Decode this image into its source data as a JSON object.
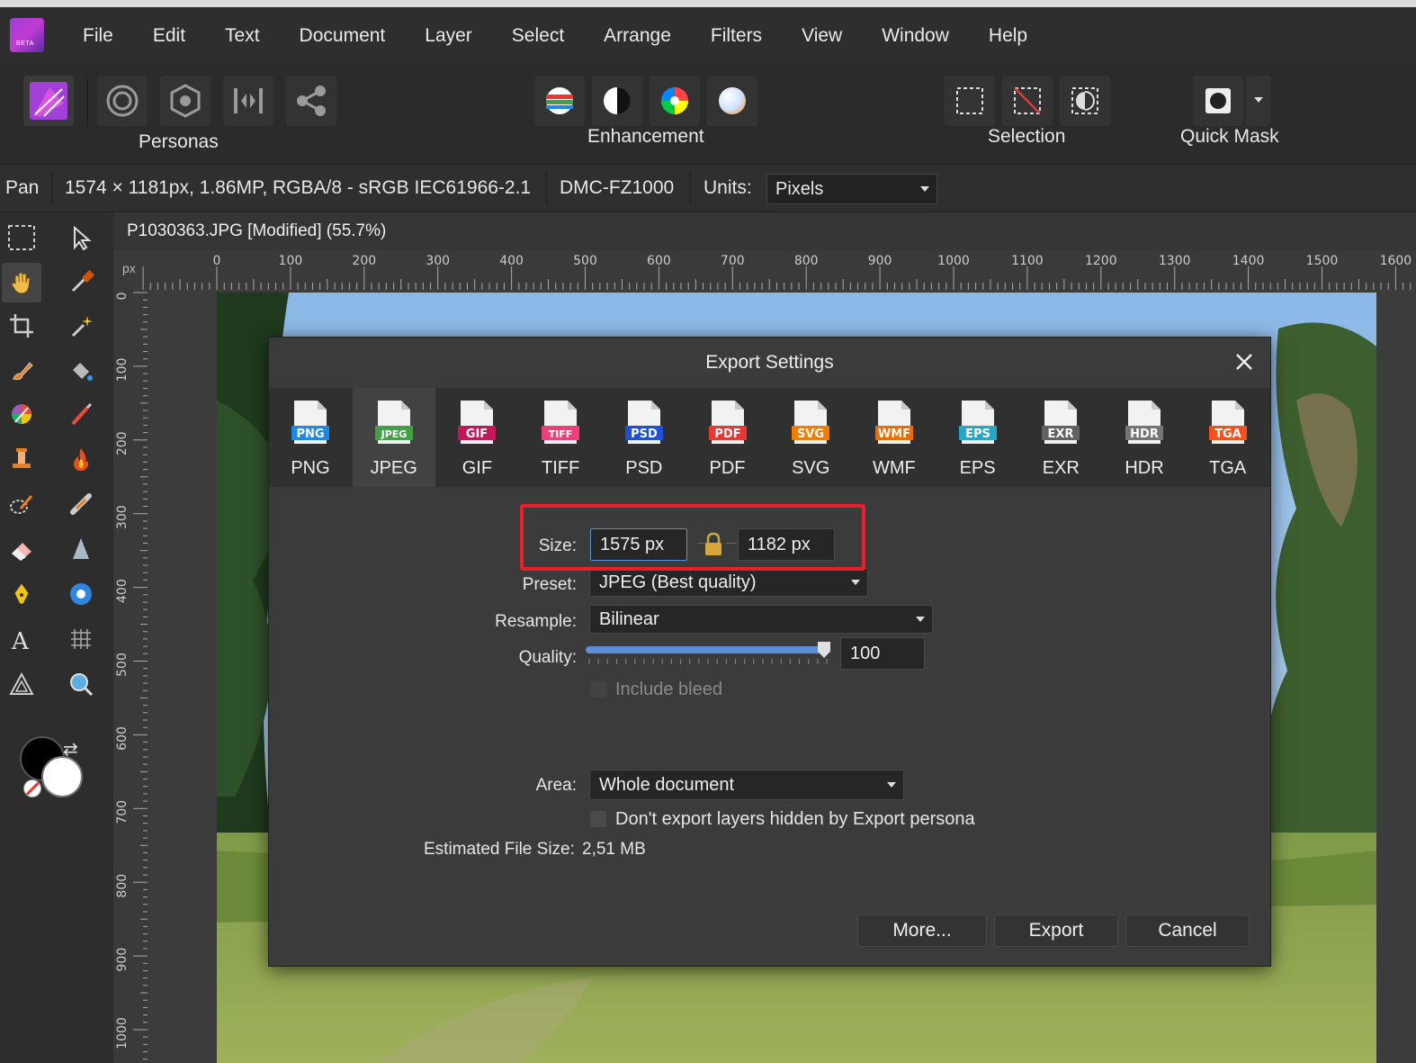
{
  "menu": [
    "File",
    "Edit",
    "Text",
    "Document",
    "Layer",
    "Select",
    "Arrange",
    "Filters",
    "View",
    "Window",
    "Help"
  ],
  "app_logo_text": "BETA",
  "toolbar": {
    "personas_label": "Personas",
    "enhancement_label": "Enhancement",
    "selection_label": "Selection",
    "quickmask_label": "Quick Mask"
  },
  "context": {
    "tool": "Pan",
    "doc_info": "1574 × 1181px, 1.86MP, RGBA/8 - sRGB IEC61966-2.1",
    "camera": "DMC-FZ1000",
    "units_label": "Units:",
    "units_value": "Pixels"
  },
  "document_tab": "P1030363.JPG [Modified] (55.7%)",
  "ruler": {
    "unit": "px",
    "h_ticks": [
      "0",
      "100",
      "200",
      "300",
      "400",
      "500",
      "600",
      "700",
      "800",
      "900",
      "1000",
      "1100",
      "1200",
      "1300",
      "1400",
      "1500",
      "1600"
    ],
    "v_ticks": [
      "0",
      "100",
      "200",
      "300",
      "400",
      "500",
      "600",
      "700",
      "800",
      "900",
      "1000"
    ]
  },
  "dialog": {
    "title": "Export Settings",
    "formats": [
      {
        "name": "PNG",
        "badge": "PNG",
        "color": "#1e88e5"
      },
      {
        "name": "JPEG",
        "badge": "JPEG",
        "color": "#43a047"
      },
      {
        "name": "GIF",
        "badge": "GIF",
        "color": "#c2185b"
      },
      {
        "name": "TIFF",
        "badge": "TIFF",
        "color": "#ec407a"
      },
      {
        "name": "PSD",
        "badge": "PSD",
        "color": "#1e4fd8"
      },
      {
        "name": "PDF",
        "badge": "PDF",
        "color": "#e53935"
      },
      {
        "name": "SVG",
        "badge": "SVG",
        "color": "#f57c00"
      },
      {
        "name": "WMF",
        "badge": "WMF",
        "color": "#ef6c00"
      },
      {
        "name": "EPS",
        "badge": "EPS",
        "color": "#26a6c9"
      },
      {
        "name": "EXR",
        "badge": "EXR",
        "color": "#616161"
      },
      {
        "name": "HDR",
        "badge": "HDR",
        "color": "#757575"
      },
      {
        "name": "TGA",
        "badge": "TGA",
        "color": "#f4511e"
      }
    ],
    "selected_format": "JPEG",
    "size_label": "Size:",
    "width_value": "1575 px",
    "height_value": "1182 px",
    "preset_label": "Preset:",
    "preset_value": "JPEG (Best quality)",
    "resample_label": "Resample:",
    "resample_value": "Bilinear",
    "quality_label": "Quality:",
    "quality_value": "100",
    "quality_fraction": 1.0,
    "include_bleed_label": "Include bleed",
    "area_label": "Area:",
    "area_value": "Whole document",
    "hidden_layers_label": "Don't export layers hidden by Export persona",
    "estimated_label": "Estimated File Size:",
    "estimated_value": "2,51 MB",
    "more_button": "More...",
    "export_button": "Export",
    "cancel_button": "Cancel"
  },
  "colors": {
    "highlight": "#e8202e",
    "accent_blue": "#5b8fd6"
  }
}
